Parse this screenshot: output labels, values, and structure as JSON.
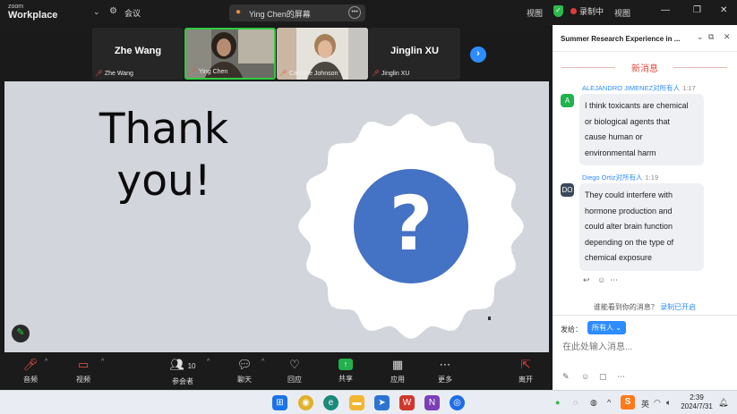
{
  "topbar": {
    "logo_small": "zoom",
    "logo_big": "Workplace",
    "meeting_label": "会议",
    "share_status": "Ying Chen的屏幕",
    "view_label": "视图",
    "record_label": "录制中",
    "record2_label": "视图"
  },
  "participants": [
    {
      "big": "Zhe Wang",
      "name": "Zhe Wang",
      "video": false
    },
    {
      "big": "",
      "name": "Ying Chen",
      "video": true,
      "active": true
    },
    {
      "big": "",
      "name": "Caroline Johnson",
      "video": true
    },
    {
      "big": "Jinglin XU",
      "name": "Jinglin XU",
      "video": false
    }
  ],
  "slide": {
    "line1": "Thank",
    "line2": "you!",
    "badge_color": "#ffffff",
    "circle_color": "#4472c4",
    "symbol": "?"
  },
  "toolbar": {
    "audio": "音频",
    "video": "视频",
    "participants": "参会者",
    "participants_count": "10",
    "chat": "聊天",
    "reactions": "回应",
    "share": "共享",
    "apps": "应用",
    "more": "更多",
    "leave": "离开"
  },
  "chat": {
    "title": "Summer Research Experience in ...",
    "new_messages": "新消息",
    "messages": [
      {
        "avatar": "A",
        "avatar_color": "#22b14c",
        "sender": "ALEJANDRO JIMENEZ对所有人",
        "time": "1:17",
        "text": [
          "I think toxicants are chemical",
          "or biological agents that",
          "cause human or",
          "environmental harm"
        ]
      },
      {
        "avatar": "DO",
        "avatar_color": "#3a4a5c",
        "sender": "Diego Ortiz对所有人",
        "time": "1:19",
        "text": [
          "They could interfere with",
          "hormone production and",
          "could alter brain function",
          "depending on the type of",
          "chemical exposure"
        ]
      }
    ],
    "hint_text": "谁能看到你的消息？",
    "hint_link": "录制已开启",
    "send_to_label": "发给：",
    "send_to_value": "所有人",
    "input_placeholder": "在此处输入消息..."
  },
  "taskbar": {
    "ime_label": "S",
    "ime_lang": "英",
    "time": "2:39",
    "date": "2024/7/31"
  }
}
